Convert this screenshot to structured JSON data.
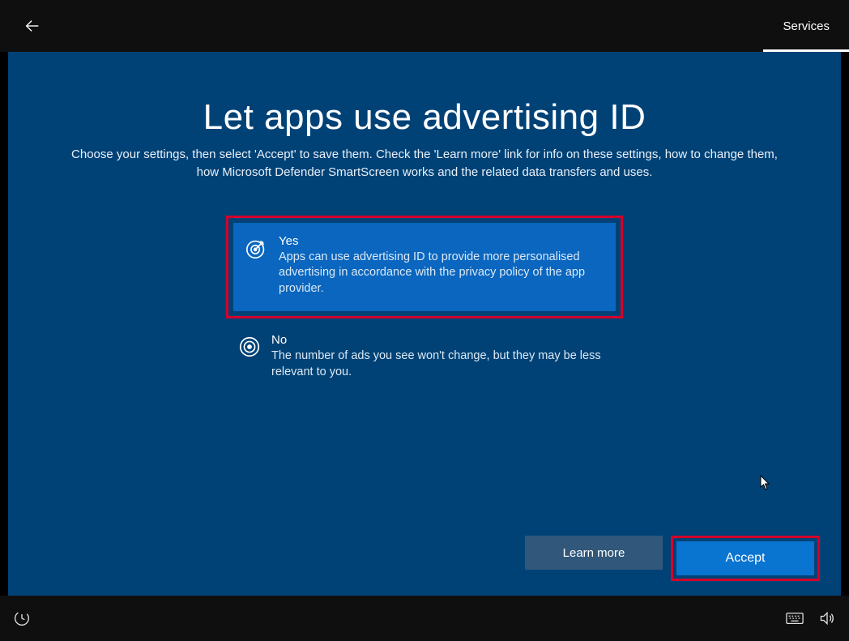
{
  "topbar": {
    "tab_label": "Services"
  },
  "page": {
    "title": "Let apps use advertising ID",
    "subtitle": "Choose your settings, then select 'Accept' to save them. Check the 'Learn more' link for info on these settings, how to change them, how Microsoft Defender SmartScreen works and the related data transfers and uses."
  },
  "options": {
    "yes": {
      "title": "Yes",
      "desc": "Apps can use advertising ID to provide more personalised advertising in accordance with the privacy policy of the app provider."
    },
    "no": {
      "title": "No",
      "desc": "The number of ads you see won't change, but they may be less relevant to you."
    }
  },
  "buttons": {
    "learn_more": "Learn more",
    "accept": "Accept"
  }
}
